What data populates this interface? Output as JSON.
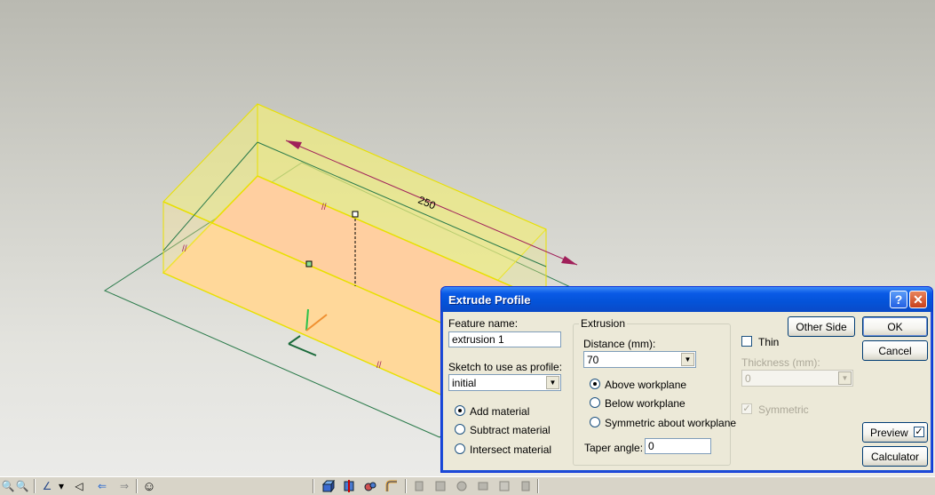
{
  "viewport": {
    "dimension_label": "250"
  },
  "toolbar": {
    "icons": [
      "zoom-icon",
      "zoom-out-icon",
      "workplane-icon",
      "dropdown-icon",
      "look-at-icon",
      "previous-view-icon",
      "next-view-icon",
      "smiley-icon",
      "extrude-icon",
      "revolve-icon",
      "sweep-icon",
      "blend-icon",
      "feature-icon-1",
      "feature-icon-2",
      "feature-icon-3",
      "feature-icon-4",
      "feature-icon-5",
      "feature-icon-6"
    ],
    "glyphs": {
      "zoom": "🔍",
      "zoom_out": "🔍",
      "workplane": "∠",
      "dropdown": "▾",
      "look_at": "◁",
      "previous": "⇐",
      "next": "⇒",
      "smiley": "☺"
    }
  },
  "dialog": {
    "title": "Extrude Profile",
    "help_glyph": "?",
    "close_glyph": "✕",
    "feature_name_label": "Feature name:",
    "feature_name_value": "extrusion 1",
    "sketch_label": "Sketch to use as profile:",
    "sketch_value": "initial",
    "material_options": [
      {
        "label": "Add material",
        "selected": true
      },
      {
        "label": "Subtract material",
        "selected": false
      },
      {
        "label": "Intersect material",
        "selected": false
      }
    ],
    "extrusion_group_label": "Extrusion",
    "distance_label": "Distance (mm):",
    "distance_value": "70",
    "workplane_options": [
      {
        "label": "Above workplane",
        "selected": true
      },
      {
        "label": "Below workplane",
        "selected": false
      },
      {
        "label": "Symmetric about workplane",
        "selected": false
      }
    ],
    "taper_label": "Taper angle:",
    "taper_value": "0",
    "other_side_button": "Other Side",
    "thin_label": "Thin",
    "thin_checked": false,
    "thickness_label": "Thickness (mm):",
    "thickness_value": "0",
    "symmetric_label": "Symmetric",
    "symmetric_checked": true,
    "ok_button": "OK",
    "cancel_button": "Cancel",
    "preview_button": "Preview",
    "preview_checked": true,
    "calculator_button": "Calculator"
  },
  "colors": {
    "titlebar": "#0a5ae6",
    "dialog_bg": "#ece9d8",
    "box_edge": "#f0e800",
    "box_face": "#ffcfa0",
    "workplane": "#2a7a4a",
    "dimension": "#a0205a"
  }
}
